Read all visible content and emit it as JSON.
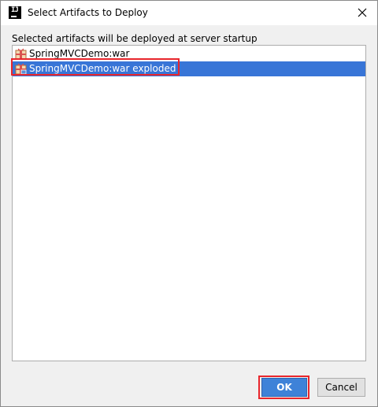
{
  "window": {
    "title": "Select Artifacts to Deploy",
    "app_icon": "intellij-idea-icon",
    "close_icon": "close-icon"
  },
  "content": {
    "label": "Selected artifacts will be deployed at server startup",
    "artifacts": [
      {
        "label": "SpringMVCDemo:war",
        "icon": "war-artifact-icon",
        "selected": false
      },
      {
        "label": "SpringMVCDemo:war exploded",
        "icon": "war-exploded-artifact-icon",
        "selected": true
      }
    ]
  },
  "buttons": {
    "ok": "OK",
    "cancel": "Cancel"
  },
  "colors": {
    "selection": "#3875d7",
    "highlight": "#e8262c",
    "ok_button": "#3e82d8"
  }
}
